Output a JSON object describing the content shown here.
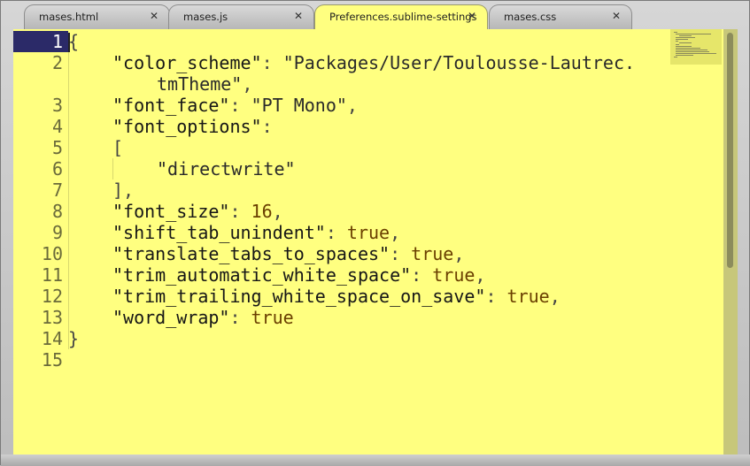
{
  "tabs": [
    {
      "label": "mases.html",
      "close": "✕",
      "active": false
    },
    {
      "label": "mases.js",
      "close": "✕",
      "active": false
    },
    {
      "label": "Preferences.sublime-settings",
      "close": "✕",
      "active": true
    },
    {
      "label": "mases.css",
      "close": "✕",
      "active": false
    }
  ],
  "editor": {
    "current_line": "1",
    "line_numbers": [
      "1",
      "2",
      "",
      "3",
      "4",
      "5",
      "6",
      "7",
      "8",
      "9",
      "10",
      "11",
      "12",
      "13",
      "14",
      "15"
    ],
    "code": {
      "l1": "{",
      "l2_key": "\"color_scheme\"",
      "l2_sep": ": ",
      "l2_val": "\"Packages/User/Toulousse-Lautrec.",
      "l2b_val": "tmTheme\"",
      "l2b_end": ",",
      "l3_key": "\"font_face\"",
      "l3_sep": ": ",
      "l3_val": "\"PT Mono\"",
      "l3_end": ",",
      "l4_key": "\"font_options\"",
      "l4_sep": ":",
      "l5": "[",
      "l6": "\"directwrite\"",
      "l7": "],",
      "l8_key": "\"font_size\"",
      "l8_sep": ": ",
      "l8_val": "16",
      "l8_end": ",",
      "l9_key": "\"shift_tab_unindent\"",
      "l9_sep": ": ",
      "l9_val": "true",
      "l9_end": ",",
      "l10_key": "\"translate_tabs_to_spaces\"",
      "l10_sep": ": ",
      "l10_val": "true",
      "l10_end": ",",
      "l11_key": "\"trim_automatic_white_space\"",
      "l11_sep": ": ",
      "l11_val": "true",
      "l11_end": ",",
      "l12_key": "\"trim_trailing_white_space_on_save\"",
      "l12_sep": ": ",
      "l12_val": "true",
      "l12_end": ",",
      "l13_key": "\"word_wrap\"",
      "l13_sep": ": ",
      "l13_val": "true",
      "l14": "}"
    }
  },
  "colors": {
    "background": "#ffff80",
    "active_line_gutter": "#2b2a68",
    "keyword": "#6a3f00"
  }
}
